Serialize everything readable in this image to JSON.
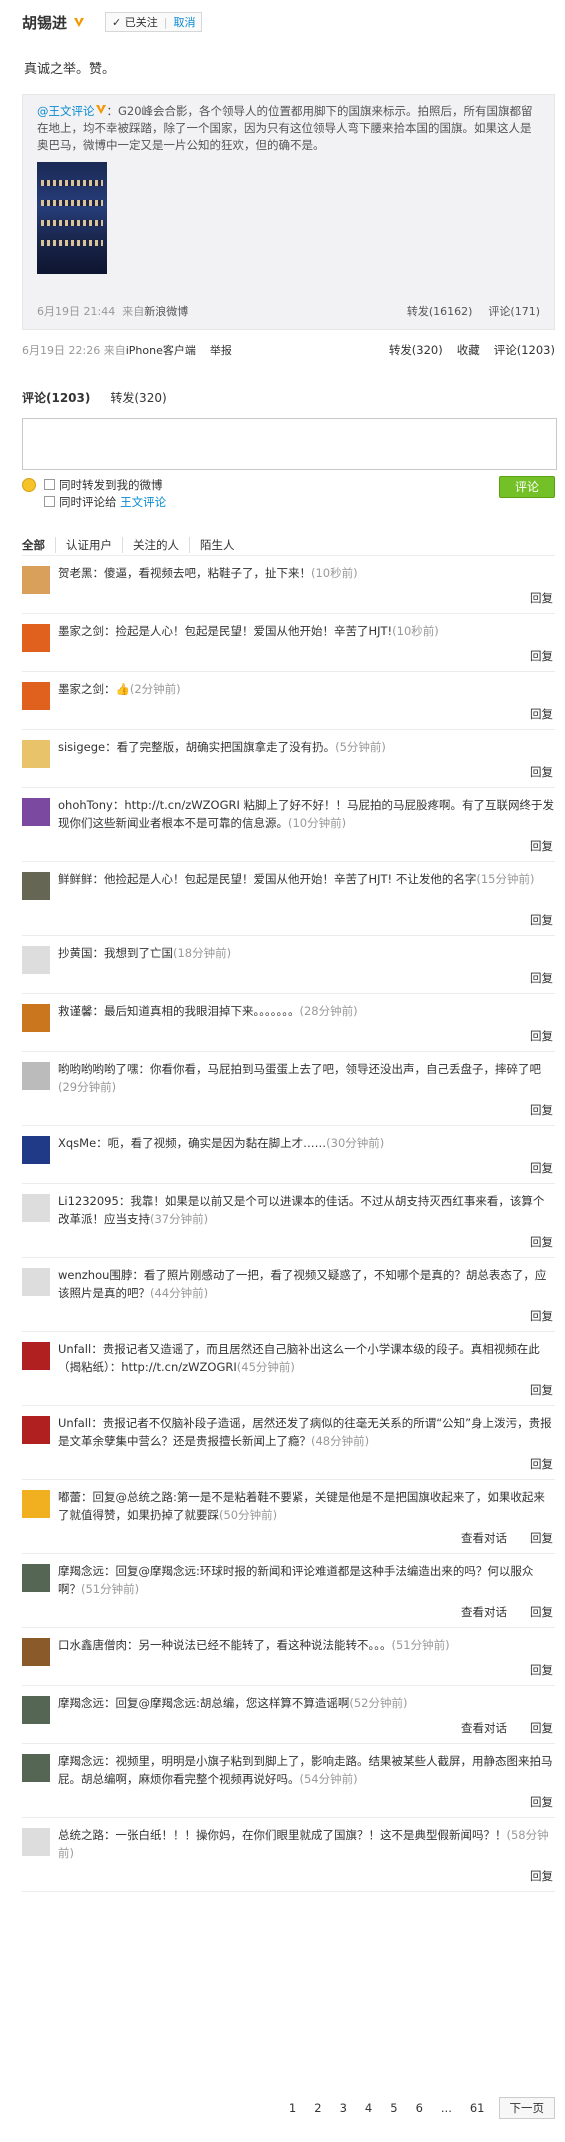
{
  "header": {
    "username": "胡锡进",
    "follow_state": "已关注",
    "separator": "|",
    "cancel_label": "取消"
  },
  "weibo": {
    "text": "真诚之举。赞。",
    "forward": {
      "author": "@王文评论",
      "text": "：G20峰会合影，各个领导人的位置都用脚下的国旗来标示。拍照后，所有国旗都留在地上，均不幸被踩踏，除了一个国家，因为只有这位领导人弯下腰来拾本国的国旗。如果这人是奥巴马，微博中一定又是一片公知的狂欢，但的确不是。",
      "time": "6月19日 21:44",
      "source_prefix": "来自",
      "source": "新浪微博",
      "repost": "转发(16162)",
      "comment": "评论(171)"
    },
    "meta": {
      "time": "6月19日 22:26",
      "source_prefix": "来自",
      "source": "iPhone客户端",
      "report": "举报",
      "repost": "转发(320)",
      "favorite": "收藏",
      "comment": "评论(1203)"
    }
  },
  "comment_box": {
    "tab_comment": "评论(1203)",
    "tab_repost": "转发(320)",
    "option1": "同时转发到我的微博",
    "option2_prefix": "同时评论给 ",
    "option2_name": "王文评论",
    "send": "评论"
  },
  "filter_tabs": [
    "全部",
    "认证用户",
    "关注的人",
    "陌生人"
  ],
  "reply_label": "回复",
  "view_conversation_label": "查看对话",
  "comments": [
    {
      "name": "贺老黑",
      "text": "：傻逼，看视频去吧，粘鞋子了，扯下来！",
      "time": "(10秒前)",
      "h": 48,
      "avatar": "#d9a05c"
    },
    {
      "name": "墨家之剑",
      "text": "：捡起是人心！包起是民望！爱国从他开始！辛苦了HJT!",
      "time": "(10秒前)",
      "h": 48,
      "avatar": "#e0601e"
    },
    {
      "name": "墨家之剑",
      "text": "：👍",
      "time": "(2分钟前)",
      "h": 48,
      "avatar": "#e0601e"
    },
    {
      "name": "sisigege",
      "text": "：看了完整版，胡确实把国旗拿走了没有扔。",
      "time": "(5分钟前)",
      "h": 48,
      "avatar": "#e8c36a"
    },
    {
      "name": "ohohTony",
      "text": "：http://t.cn/zWZOGRI 粘脚上了好不好！！马屁拍的马屁股疼啊。有了互联网终于发现你们这些新闻业者根本不是可靠的信息源。",
      "time": "(10分钟前)",
      "h": 64,
      "avatar": "#7b4aa0"
    },
    {
      "name": "鲜鲜鲜",
      "text": "：他捡起是人心！包起是民望！爱国从他开始！辛苦了HJT! 不让发他的名字",
      "time": "(15分钟前)",
      "h": 64,
      "avatar": "#666655"
    },
    {
      "name": "抄黄国",
      "text": "：我想到了亡国",
      "time": "(18分钟前)",
      "h": 48,
      "avatar": "#dddddd"
    },
    {
      "name": "救谨馨",
      "text": "：最后知道真相的我眼泪掉下来。。。。。。。",
      "time": "(28分钟前)",
      "h": 48,
      "avatar": "#c9761f"
    },
    {
      "name": "哟哟哟哟哟了嘿",
      "text": "：你看你看，马屁拍到马蛋蛋上去了吧，领导还没出声，自己丢盘子，摔碎了吧",
      "time": "(29分钟前)",
      "h": 64,
      "avatar": "#bbbbbb"
    },
    {
      "name": "XqsMe",
      "text": "：呃，看了视频，确实是因为黏在脚上才……",
      "time": "(30分钟前)",
      "h": 48,
      "avatar": "#203a88"
    },
    {
      "name": "Li1232095",
      "text": "：我靠！如果是以前又是个可以进课本的佳话。不过从胡支持灭西红事来看，该算个改革派！应当支持",
      "time": "(37分钟前)",
      "h": 64,
      "avatar": "#dddddd"
    },
    {
      "name": "wenzhou围脖",
      "text": "：看了照片刚感动了一把，看了视频又疑惑了，不知哪个是真的？胡总表态了，应该照片是真的吧？",
      "time": "(44分钟前)",
      "h": 64,
      "avatar": "#dddddd"
    },
    {
      "name": "Unfall",
      "text": "：贵报记者又造谣了，而且居然还自己脑补出这么一个小学课本级的段子。真相视频在此（揭粘纸）：http://t.cn/zWZOGRI",
      "time": "(45分钟前)",
      "h": 64,
      "avatar": "#b02020"
    },
    {
      "name": "Unfall",
      "text": "：贵报记者不仅脑补段子造谣，居然还发了病似的往毫无关系的所谓“公知”身上泼污，贵报是文革余孽集中营么？还是贵报擅长新闻上了瘾？",
      "time": "(48分钟前)",
      "h": 64,
      "avatar": "#b02020"
    },
    {
      "name": "嘟蕾",
      "text": "：回复@总统之路:第一是不是粘着鞋不要紧，关键是他是不是把国旗收起来了，如果收起来了就值得赞，如果扔掉了就要踩",
      "time": "(50分钟前)",
      "h": 64,
      "avatar": "#f0b020",
      "conv": true
    },
    {
      "name": "摩羯念远",
      "text": "：回复@摩羯念远:环球时报的新闻和评论难道都是这种手法编造出来的吗？何以服众啊？",
      "time": "(51分钟前)",
      "h": 64,
      "avatar": "#556655",
      "conv": true
    },
    {
      "name": "口水鑫唐僧肉",
      "text": "：另一种说法已经不能转了，看这种说法能转不。。。",
      "time": "(51分钟前)",
      "h": 48,
      "avatar": "#8a5a2a"
    },
    {
      "name": "摩羯念远",
      "text": "：回复@摩羯念远:胡总编，您这样算不算造谣啊",
      "time": "(52分钟前)",
      "h": 48,
      "avatar": "#556655",
      "conv": true
    },
    {
      "name": "摩羯念远",
      "text": "：视频里，明明是小旗子粘到到脚上了，影响走路。结果被某些人截屏，用静态图来拍马屁。胡总编啊，麻烦你看完整个视频再说好吗。",
      "time": "(54分钟前)",
      "h": 64,
      "avatar": "#556655"
    },
    {
      "name": "总统之路",
      "text": "：一张白纸！！！操你妈，在你们眼里就成了国旗？！这不是典型假新闻吗？！",
      "time": "(58分钟前)",
      "h": 64,
      "avatar": "#dddddd"
    }
  ],
  "pager": {
    "pages": [
      "1",
      "2",
      "3",
      "4",
      "5",
      "6",
      "...",
      "61"
    ],
    "next": "下一页"
  }
}
